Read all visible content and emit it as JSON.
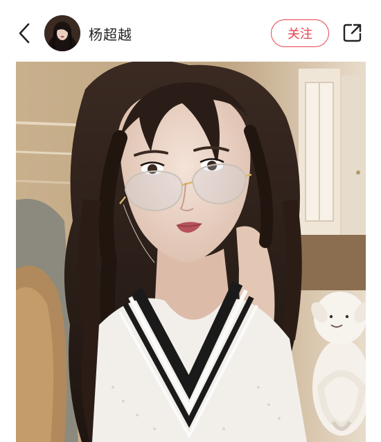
{
  "header": {
    "back_icon": "chevron-left-icon",
    "username": "杨超越",
    "follow_label": "关注",
    "share_icon": "share-out-icon",
    "accent_color": "#e8424c"
  },
  "post": {
    "image_alt": "selfie-photo"
  }
}
